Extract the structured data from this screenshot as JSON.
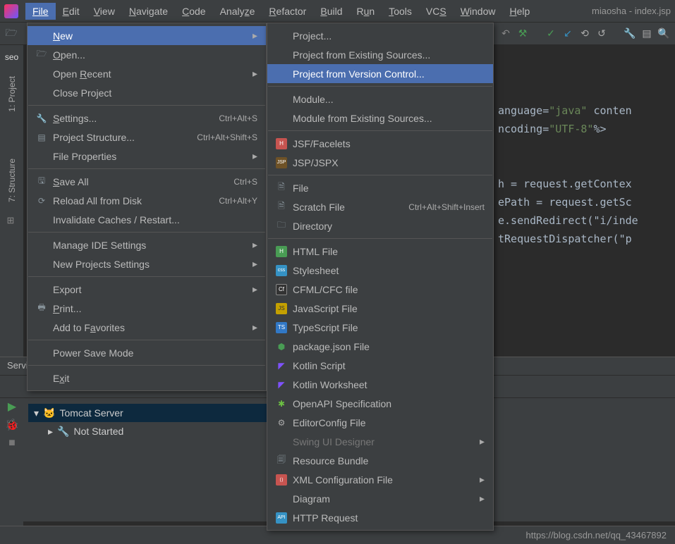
{
  "menubar": {
    "items": [
      "File",
      "Edit",
      "View",
      "Navigate",
      "Code",
      "Analyze",
      "Refactor",
      "Build",
      "Run",
      "Tools",
      "VCS",
      "Window",
      "Help"
    ],
    "window_title": "miaosha - index.jsp"
  },
  "left_tabs": {
    "seo": "seo",
    "project": "1: Project",
    "structure": "7: Structure"
  },
  "toolbar_icons": [
    "folder",
    "back",
    "hammer",
    "tick",
    "blue-down",
    "clock",
    "undo",
    "wrench",
    "panel",
    "search"
  ],
  "file_menu": {
    "items": [
      {
        "label": "New",
        "ul": 0,
        "hl": true,
        "arrow": true
      },
      {
        "label": "Open...",
        "ul": 0,
        "icon": "folder"
      },
      {
        "label": "Open Recent",
        "ul": 5,
        "arrow": true
      },
      {
        "label": "Close Project"
      },
      {
        "sep": true
      },
      {
        "label": "Settings...",
        "ul": 0,
        "shortcut": "Ctrl+Alt+S",
        "icon": "wrench"
      },
      {
        "label": "Project Structure...",
        "shortcut": "Ctrl+Alt+Shift+S",
        "icon": "project"
      },
      {
        "label": "File Properties",
        "arrow": true
      },
      {
        "sep": true
      },
      {
        "label": "Save All",
        "ul": 0,
        "shortcut": "Ctrl+S",
        "icon": "save"
      },
      {
        "label": "Reload All from Disk",
        "shortcut": "Ctrl+Alt+Y",
        "icon": "reload"
      },
      {
        "label": "Invalidate Caches / Restart..."
      },
      {
        "sep": true
      },
      {
        "label": "Manage IDE Settings",
        "arrow": true
      },
      {
        "label": "New Projects Settings",
        "arrow": true
      },
      {
        "sep": true
      },
      {
        "label": "Export",
        "arrow": true
      },
      {
        "label": "Print...",
        "ul": 0,
        "icon": "print"
      },
      {
        "label": "Add to Favorites",
        "ul": 7,
        "arrow": true
      },
      {
        "sep": true
      },
      {
        "label": "Power Save Mode"
      },
      {
        "sep": true
      },
      {
        "label": "Exit",
        "ul": 1
      }
    ]
  },
  "new_submenu": {
    "items": [
      {
        "label": "Project..."
      },
      {
        "label": "Project from Existing Sources..."
      },
      {
        "label": "Project from Version Control...",
        "hl": true
      },
      {
        "sep": true
      },
      {
        "label": "Module..."
      },
      {
        "label": "Module from Existing Sources..."
      },
      {
        "sep": true
      },
      {
        "label": "JSF/Facelets",
        "icon": "H"
      },
      {
        "label": "JSP/JSPX",
        "icon": "JSP"
      },
      {
        "sep": true
      },
      {
        "label": "File",
        "icon": "file"
      },
      {
        "label": "Scratch File",
        "shortcut": "Ctrl+Alt+Shift+Insert",
        "icon": "scratch"
      },
      {
        "label": "Directory",
        "icon": "dir"
      },
      {
        "sep": true
      },
      {
        "label": "HTML File",
        "icon": "H5"
      },
      {
        "label": "Stylesheet",
        "icon": "css"
      },
      {
        "label": "CFML/CFC file",
        "icon": "Cf"
      },
      {
        "label": "JavaScript File",
        "icon": "JS"
      },
      {
        "label": "TypeScript File",
        "icon": "TS"
      },
      {
        "label": "package.json File",
        "icon": "pkg"
      },
      {
        "label": "Kotlin Script",
        "icon": "K"
      },
      {
        "label": "Kotlin Worksheet",
        "icon": "K"
      },
      {
        "label": "OpenAPI Specification",
        "icon": "api"
      },
      {
        "label": "EditorConfig File",
        "icon": "ec"
      },
      {
        "label": "Swing UI Designer",
        "arrow": true,
        "disabled": true
      },
      {
        "label": "Resource Bundle",
        "icon": "rb"
      },
      {
        "label": "XML Configuration File",
        "icon": "xml",
        "arrow": true
      },
      {
        "label": "Diagram",
        "arrow": true
      },
      {
        "label": "HTTP Request",
        "icon": "api2"
      }
    ]
  },
  "editor": {
    "line1a": "anguage=",
    "line1b": "\"java\"",
    "line1c": " conten",
    "line2a": "ncoding=",
    "line2b": "\"UTF-8\"",
    "line2c": "%>",
    "line4": "h = request.getContex",
    "line5": "ePath = request.getSc",
    "line6": "e.sendRedirect(\"i/inde",
    "line7": "tRequestDispatcher(\"p"
  },
  "services": {
    "title": "Services",
    "tree": {
      "root": "Tomcat Server",
      "child": "Not Started"
    }
  },
  "status": {
    "url": "https://blog.csdn.net/qq_43467892"
  }
}
